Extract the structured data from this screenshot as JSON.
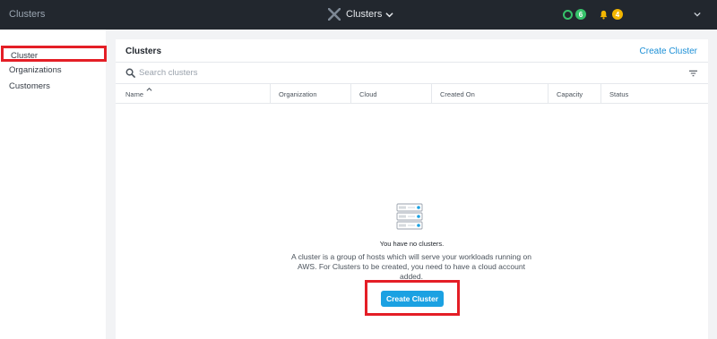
{
  "topbar": {
    "app_title": "Clusters",
    "center_title": "Clusters",
    "health_count": "6",
    "alerts_count": "4",
    "colors": {
      "bg": "#22272e",
      "health": "#36c26a",
      "alert": "#f3b600"
    }
  },
  "sidebar": {
    "items": [
      {
        "label": "Cluster",
        "active": true
      },
      {
        "label": "Organizations"
      },
      {
        "label": "Customers"
      }
    ]
  },
  "panel": {
    "title": "Clusters",
    "create_link": "Create Cluster",
    "search_placeholder": "Search clusters",
    "columns": [
      "Name",
      "Organization",
      "Cloud",
      "Created On",
      "Capacity",
      "Status"
    ],
    "empty": {
      "title": "You have no clusters.",
      "description": "A cluster is a group of hosts which will serve your workloads running on AWS. For Clusters to be created, you need to have a cloud account added.",
      "button": "Create Cluster"
    }
  },
  "icons": [
    "x-logo-icon",
    "chevron-down-icon",
    "health-ring-icon",
    "bell-icon",
    "search-icon",
    "filter-icon",
    "sort-icon",
    "server-stack-icon"
  ],
  "accent": {
    "link": "#1b8fd6",
    "button": "#1ba1e2",
    "highlight": "#e41e26"
  }
}
